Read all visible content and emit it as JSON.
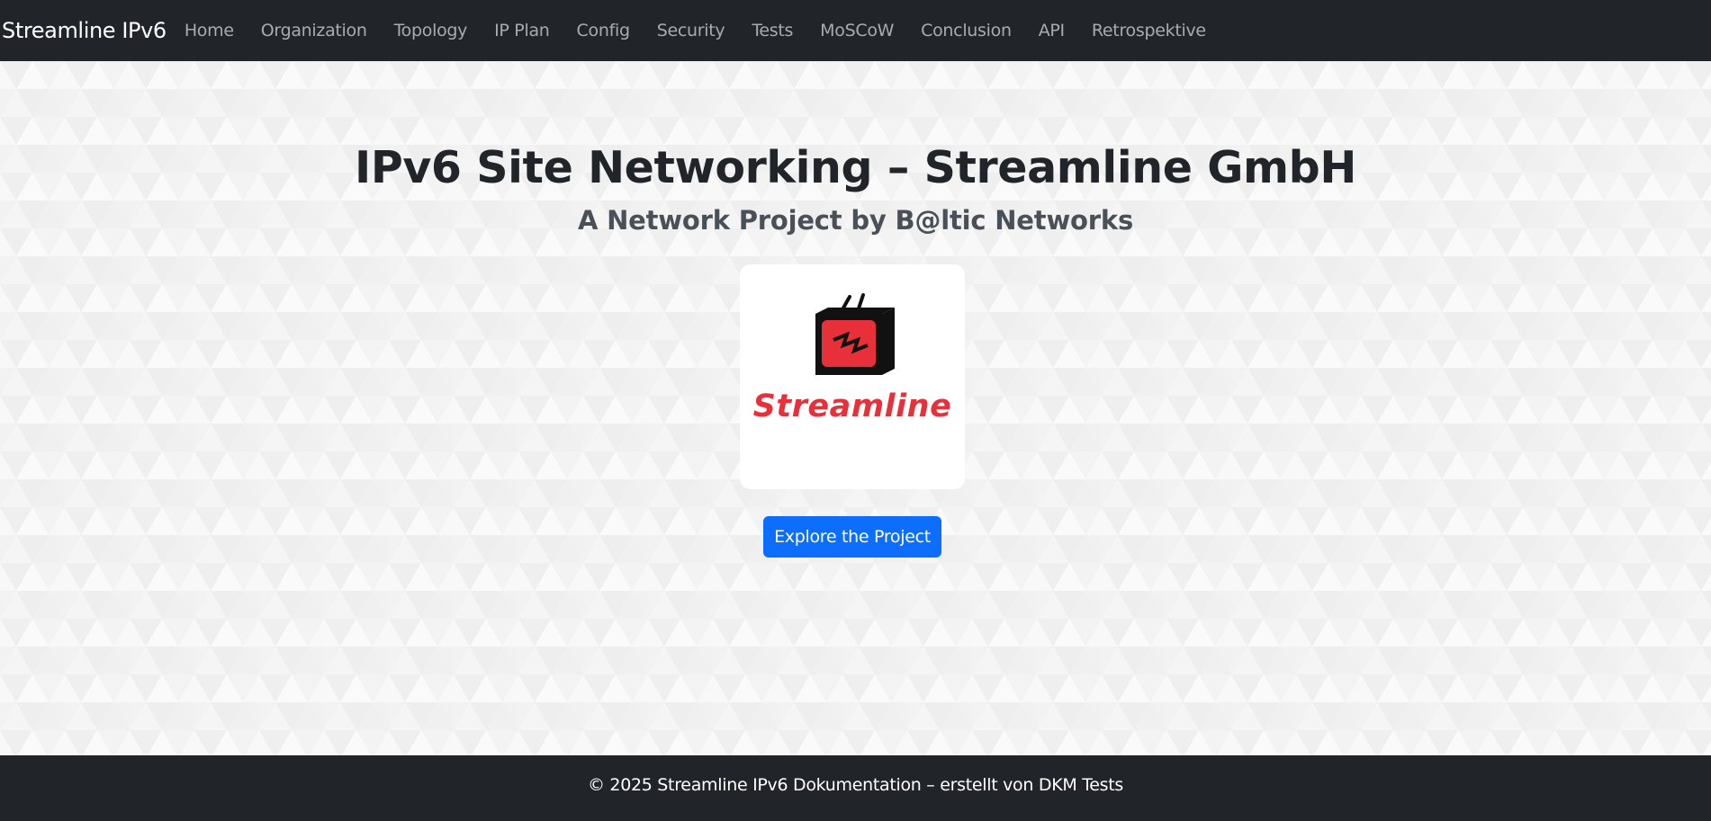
{
  "navbar": {
    "brand": "Streamline IPv6",
    "links": [
      {
        "label": "Home"
      },
      {
        "label": "Organization"
      },
      {
        "label": "Topology"
      },
      {
        "label": "IP Plan"
      },
      {
        "label": "Config"
      },
      {
        "label": "Security"
      },
      {
        "label": "Tests"
      },
      {
        "label": "MoSCoW"
      },
      {
        "label": "Conclusion"
      },
      {
        "label": "API"
      },
      {
        "label": "Retrospektive"
      }
    ]
  },
  "hero": {
    "title": "IPv6 Site Networking – Streamline GmbH",
    "subtitle": "A Network Project by B@ltic Networks",
    "logo": {
      "icon": "tv-icon",
      "wordmark": "Streamline"
    },
    "cta_label": "Explore the Project"
  },
  "footer": {
    "text": "© 2025 Streamline IPv6 Dokumentation – erstellt von DKM Tests"
  },
  "colors": {
    "navbar_bg": "#212529",
    "nav_link": "#a8acb1",
    "accent": "#0d6efd",
    "logo_red": "#e8303a"
  }
}
